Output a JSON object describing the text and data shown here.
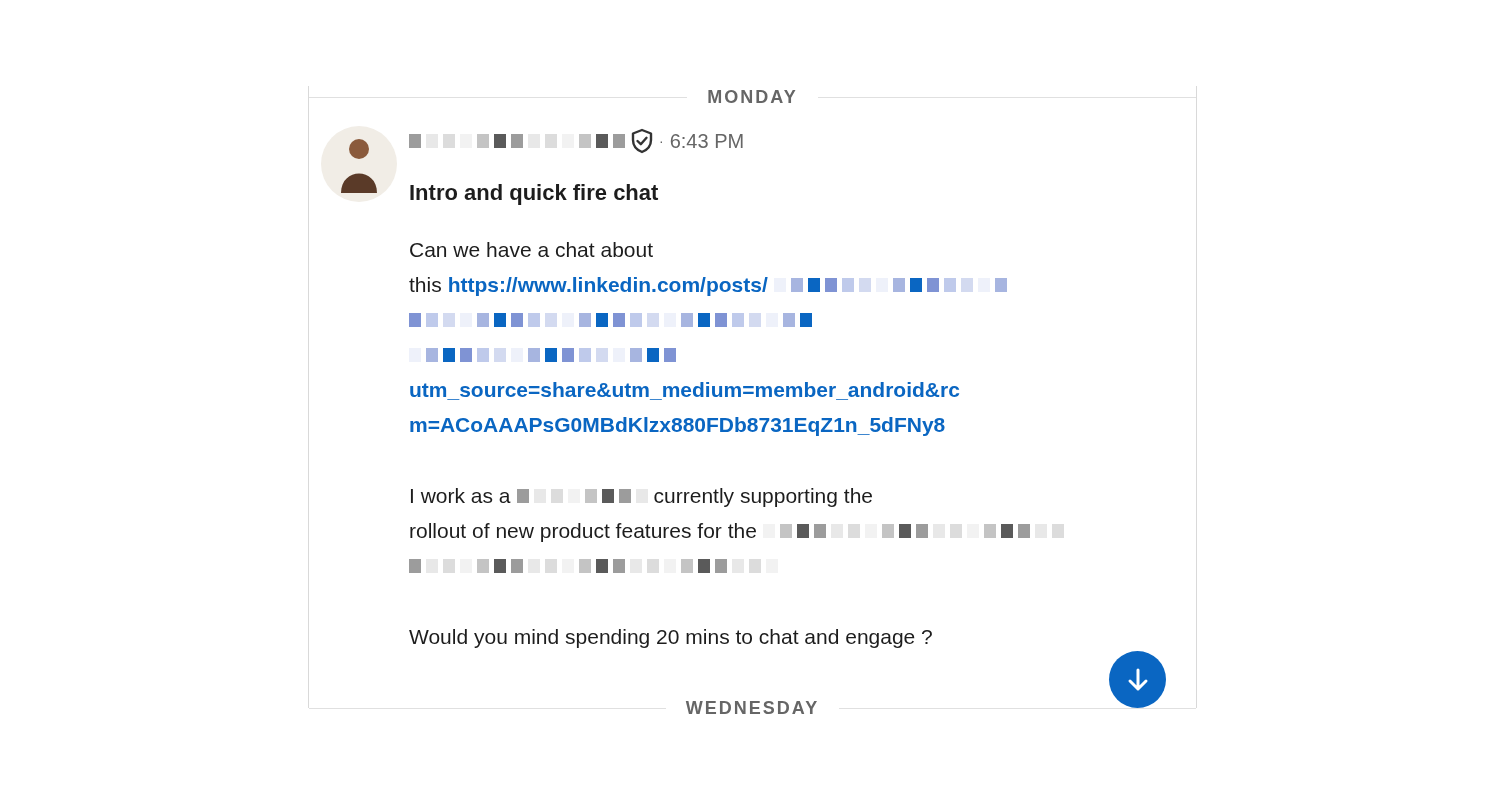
{
  "top_divider": "MONDAY",
  "message": {
    "sender_verified": true,
    "time_separator": "·",
    "time": "6:43 PM",
    "subject": "Intro and quick fire chat",
    "paragraphs": [
      {
        "lines": [
          [
            {
              "kind": "text",
              "text": "Can we have a chat about"
            }
          ],
          [
            {
              "kind": "text",
              "text": "this"
            },
            {
              "kind": "link",
              "text": "https://www.linkedin.com/posts/"
            },
            {
              "kind": "redacted_link"
            }
          ],
          [
            {
              "kind": "redacted_link"
            }
          ],
          [
            {
              "kind": "redacted_link"
            }
          ],
          [
            {
              "kind": "link",
              "text": "utm_source=share&utm_medium=member_android&rc"
            }
          ],
          [
            {
              "kind": "link",
              "text": "m=ACoAAAPsG0MBdKlzx880FDb8731EqZ1n_5dFNy8"
            }
          ]
        ]
      },
      {
        "lines": [
          [
            {
              "kind": "text",
              "text": "I work as a"
            },
            {
              "kind": "redacted_text"
            },
            {
              "kind": "text",
              "text": "currently supporting the"
            }
          ],
          [
            {
              "kind": "text",
              "text": "rollout of new product features for the"
            },
            {
              "kind": "redacted_text"
            }
          ],
          [
            {
              "kind": "redacted_text"
            }
          ]
        ]
      },
      {
        "lines": [
          [
            {
              "kind": "text",
              "text": "Would you mind spending 20 mins to chat and engage ?"
            }
          ]
        ]
      }
    ]
  },
  "bottom_divider": "WEDNESDAY"
}
